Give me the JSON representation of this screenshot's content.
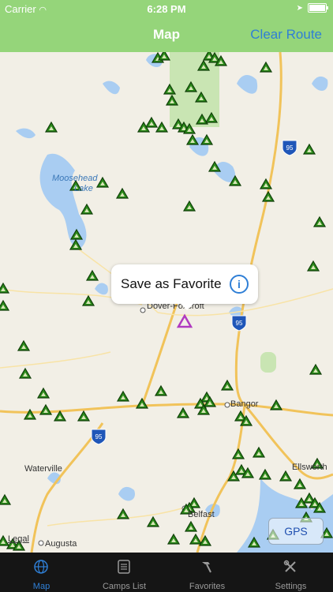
{
  "status_bar": {
    "carrier": "Carrier",
    "time": "6:28 PM"
  },
  "nav": {
    "title": "Map",
    "clear_route": "Clear Route"
  },
  "map": {
    "callout": {
      "text": "Save as Favorite",
      "info_glyph": "i"
    },
    "place_labels": {
      "moosehead": "Moosehead",
      "moosehead2": "Lake",
      "dover": "Dover-Foxcroft",
      "bangor": "Bangor",
      "waterville": "Waterville",
      "augusta": "Augusta",
      "belfast": "Belfast",
      "ellsworth": "Ellsworth"
    },
    "highway_95": "95",
    "gps_button": "GPS",
    "legal": "Legal",
    "colors": {
      "water": "#a9cdf2",
      "park": "#c9e5b3",
      "road": "#f1c35a",
      "campsite": "#2b8a1a",
      "selected": "#b03ac0"
    }
  },
  "tabs": [
    {
      "label": "Map",
      "icon": "globe-icon",
      "active": true
    },
    {
      "label": "Camps List",
      "icon": "list-icon",
      "active": false
    },
    {
      "label": "Favorites",
      "icon": "hammer-icon",
      "active": false
    },
    {
      "label": "Settings",
      "icon": "tools-icon",
      "active": false
    }
  ]
}
